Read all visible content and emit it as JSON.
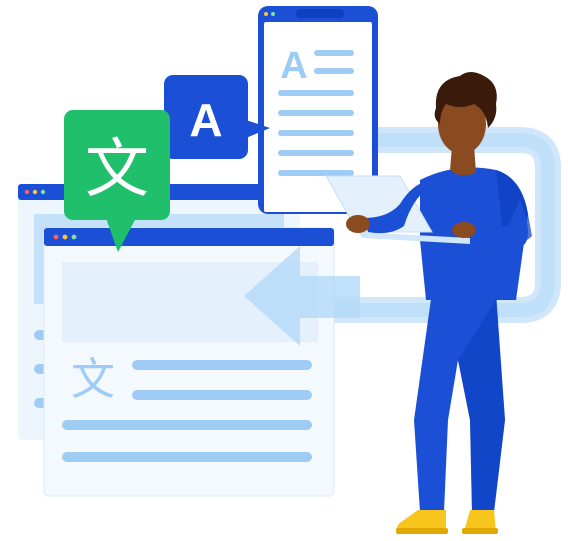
{
  "illustration": {
    "source_glyph": "文",
    "target_glyph": "A",
    "doc_glyph_small": "文",
    "doc_letter": "A"
  },
  "colors": {
    "primary_blue": "#1a4fd6",
    "deep_blue": "#0d3fbf",
    "light_blue": "#9fccf5",
    "pale_blue": "#e4f1fc",
    "accent_green": "#1fbf6b",
    "skin": "#8a4b21",
    "hair": "#3a1b0b",
    "shoe_yellow": "#f7c51c",
    "window_dot_red": "#ff5f57",
    "window_dot_yellow": "#ffc533"
  },
  "icons": [
    "translate-source-bubble-icon",
    "translate-target-bubble-icon",
    "browser-window-icon",
    "mobile-device-icon",
    "laptop-icon",
    "refresh-arrow-icon"
  ]
}
